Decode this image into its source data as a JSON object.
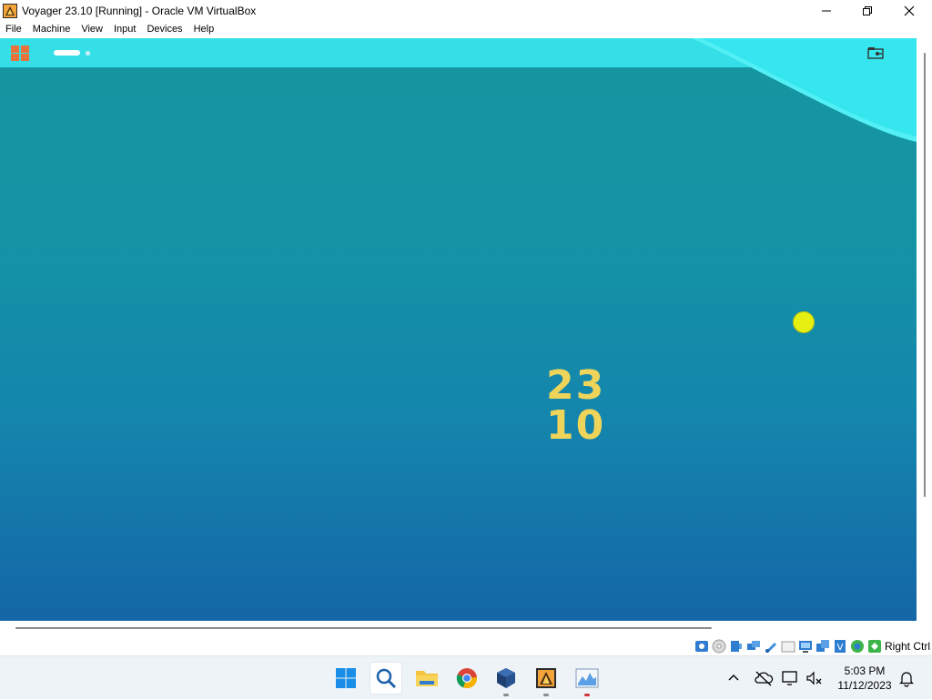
{
  "window": {
    "title": "Voyager 23.10 [Running] - Oracle VM VirtualBox"
  },
  "menu": {
    "items": [
      "File",
      "Machine",
      "View",
      "Input",
      "Devices",
      "Help"
    ]
  },
  "guest": {
    "version_line1": "23",
    "version_line2": "10",
    "colors": {
      "topbar": "#35dfe8",
      "background_top": "#16959f",
      "background_bottom": "#1466a6",
      "version_text": "#efd45a",
      "cursor": "#e6ef12",
      "logo": "#e8733a"
    }
  },
  "statusbar": {
    "icons": [
      "hard-disk-icon",
      "optical-drive-icon",
      "audio-icon",
      "network-icon",
      "usb-icon",
      "shared-folders-icon",
      "display-icon",
      "recording-icon",
      "cpu-icon",
      "mouse-integration-icon",
      "keyboard-icon"
    ],
    "host_key": "Right Ctrl"
  },
  "taskbar": {
    "apps": [
      "windows-start-icon",
      "search-icon",
      "file-explorer-icon",
      "chrome-icon",
      "virtualbox-icon",
      "virtualbox-vm-icon",
      "task-manager-icon"
    ],
    "clock_time": "5:03 PM",
    "clock_date": "11/12/2023"
  }
}
